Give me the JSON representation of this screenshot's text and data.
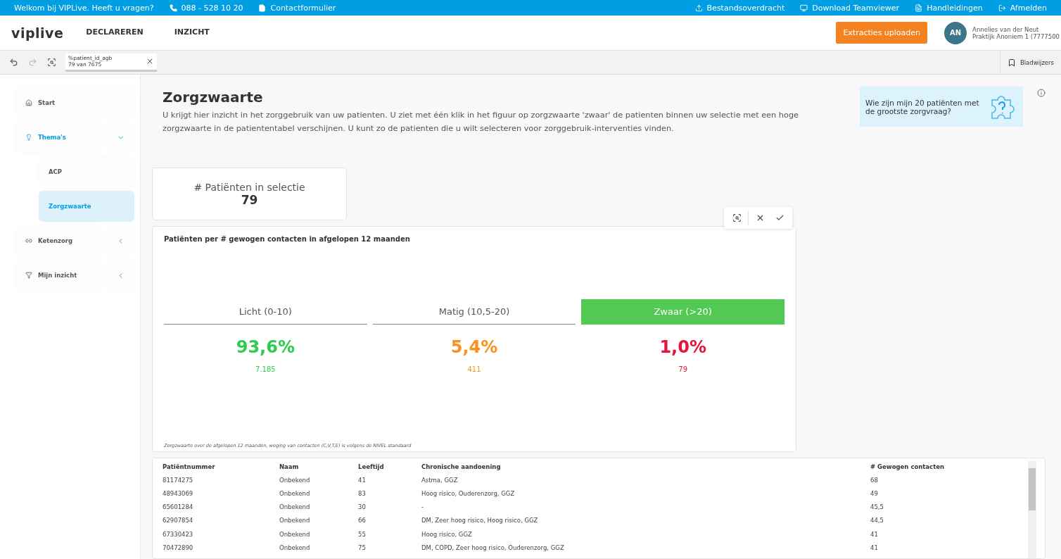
{
  "top_bar": {
    "welcome": "Welkom bij VIPLive. Heeft u vragen?",
    "phone": "088 - 528 10 20",
    "contact": "Contactformulier",
    "links": [
      "Bestandsoverdracht",
      "Download Teamviewer",
      "Handleidingen",
      "Afmelden"
    ]
  },
  "header": {
    "logo": "viplive",
    "nav": [
      {
        "label": "DECLAREREN",
        "selected": false
      },
      {
        "label": "INZICHT",
        "selected": false
      }
    ],
    "upload_button": "Extracties uploaden",
    "user": {
      "initials": "AN",
      "name": "Annelies van der Neut",
      "practice": "Praktijk Anoniem 1 (7777500"
    }
  },
  "selection_bar": {
    "chip": {
      "field": "%patient_id_agb",
      "count": "79 van 7675"
    },
    "bookmarks": "Bladwijzers"
  },
  "sidebar": {
    "items": [
      {
        "label": "Start",
        "selected": false
      },
      {
        "label": "Thema's",
        "selected": false,
        "expanded": true,
        "children": [
          {
            "label": "ACP",
            "selected": false
          },
          {
            "label": "Zorgzwaarte",
            "selected": true
          }
        ]
      },
      {
        "label": "Ketenzorg",
        "selected": false,
        "expanded": false
      },
      {
        "label": "Mijn inzicht",
        "selected": false,
        "expanded": false
      }
    ]
  },
  "page": {
    "title": "Zorgzwaarte",
    "description": "U krijgt hier inzicht in het zorggebruik van uw patienten. U ziet met één klik in het figuur op zorgzwaarte 'zwaar' de patienten binnen uw selectie met een hoge zorgzwaarte in de patiententabel verschijnen. U kunt zo de patienten die u wilt selecteren voor zorggebruik-interventies vinden.",
    "help_tile": "Wie zijn mijn 20 patiënten met de grootste zorgvraag?"
  },
  "kpi": {
    "label": "# Patiënten in selectie",
    "value": "79"
  },
  "chart_panel": {
    "title": "Patiënten per # gewogen contacten in afgelopen 12 maanden",
    "categories": [
      {
        "label": "Licht (0-10)",
        "selected": false,
        "percent": "93,6%",
        "count": "7.185",
        "color": "#2ecc4e"
      },
      {
        "label": "Matig (10,5-20)",
        "selected": false,
        "percent": "5,4%",
        "count": "411",
        "color": "#f7931e"
      },
      {
        "label": "Zwaar (>20)",
        "selected": true,
        "percent": "1,0%",
        "count": "79",
        "color": "#e8153a"
      }
    ],
    "footnote": "Zorgzwaarte over de afgelopen 12 maanden, weging van contacten (C,V,T,E) is volgens de NIVEL standaard"
  },
  "table": {
    "columns": [
      "Patiëntnummer",
      "Naam",
      "Leeftijd",
      "Chronische aandoening",
      "# Gewogen contacten"
    ],
    "rows": [
      [
        "81174275",
        "Onbekend",
        "41",
        "Astma, GGZ",
        "68"
      ],
      [
        "48943069",
        "Onbekend",
        "83",
        "Hoog risico, Ouderenzorg, GGZ",
        "49"
      ],
      [
        "65601284",
        "Onbekend",
        "30",
        "-",
        "45,5"
      ],
      [
        "62907854",
        "Onbekend",
        "66",
        "DM, Zeer hoog risico, Hoog risico, GGZ",
        "44,5"
      ],
      [
        "67330423",
        "Onbekend",
        "55",
        "Hoog risico, GGZ",
        "41"
      ],
      [
        "70472890",
        "Onbekend",
        "75",
        "DM, COPD, Zeer hoog risico, Ouderenzorg, GGZ",
        "41"
      ]
    ]
  }
}
